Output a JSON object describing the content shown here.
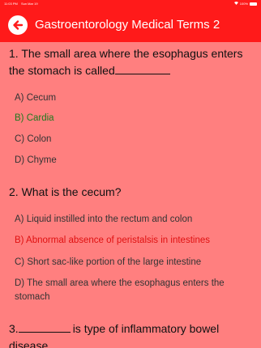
{
  "status_bar": {
    "time": "11:03 PM",
    "date": "Sun Mar 19",
    "wifi": "wifi-icon",
    "battery_text": "100%",
    "battery_icon": "battery-icon"
  },
  "header": {
    "title": "Gastroentorology Medical Terms 2",
    "back_icon": "arrow-left-circle-icon",
    "background": "#ff1a1a"
  },
  "colors": {
    "page_background": "#ff7f7f",
    "correct": "#1e7a1e",
    "wrong": "#e01010"
  },
  "questions": [
    {
      "text_before": "1. The small area where the esophagus enters the stomach is called",
      "options": [
        "A) Cecum",
        "B) Cardia",
        "C) Colon",
        "D) Chyme"
      ],
      "states": [
        "normal",
        "correct",
        "normal",
        "normal"
      ]
    },
    {
      "text": "2. What is the cecum?",
      "options": [
        "A) Liquid instilled into the rectum and colon",
        "B) Abnormal absence of peristalsis in intestines",
        "C) Short sac-like portion of the large intestine",
        "D) The small area where the esophagus enters the stomach"
      ],
      "states": [
        "normal",
        "wrong",
        "normal",
        "normal"
      ]
    },
    {
      "text_before": "3.",
      "text_after": "is type of inflammatory bowel disease."
    }
  ]
}
